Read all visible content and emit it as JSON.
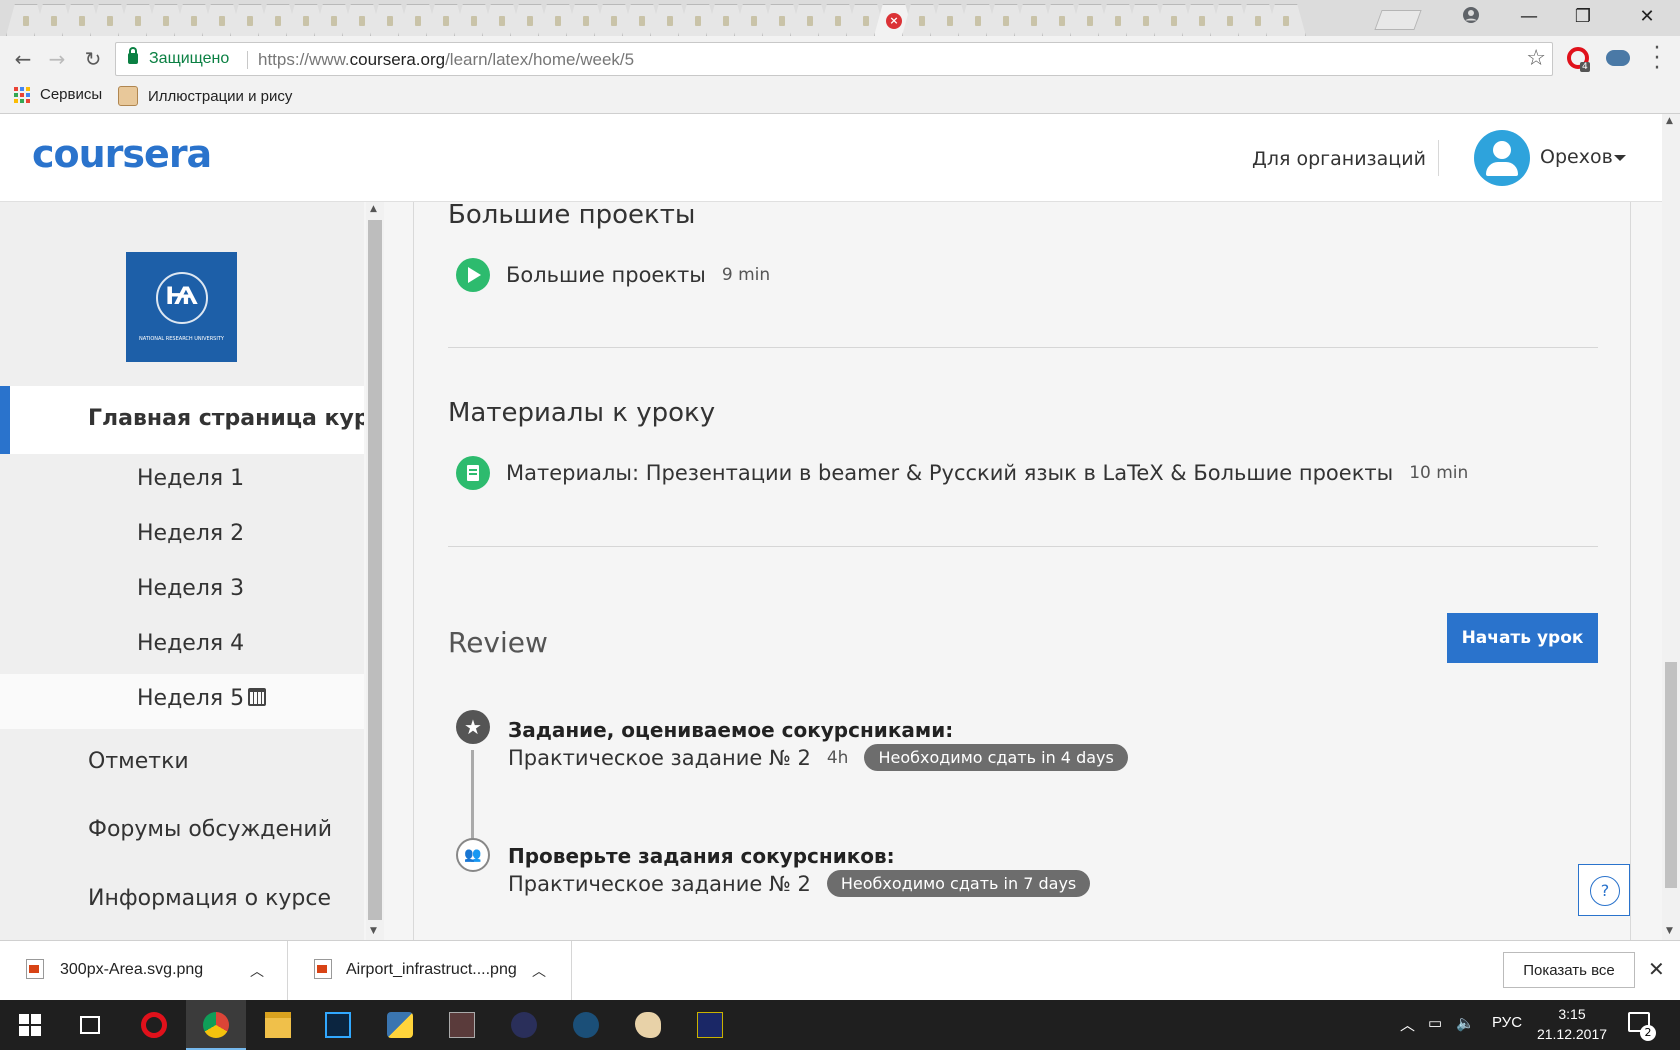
{
  "browser": {
    "secure_label": "Защищено",
    "url_prefix": "https://www.",
    "url_host": "coursera.org",
    "url_path": "/learn/latex/home/week/5",
    "bookmarks": [
      "Сервисы",
      "Иллюстрации и рису"
    ],
    "extension_badge": "4"
  },
  "header": {
    "logo": "coursera",
    "org_link": "Для организаций",
    "username": "Орехов"
  },
  "sidebar": {
    "logo_glyph": "Ѩ",
    "logo_caption": "NATIONAL RESEARCH UNIVERSITY",
    "home": "Главная страница курса",
    "weeks": [
      "Неделя 1",
      "Неделя 2",
      "Неделя 3",
      "Неделя 4",
      "Неделя 5"
    ],
    "current_week": "Неделя 5",
    "links": [
      "Отметки",
      "Форумы обсуждений",
      "Информация о курсе"
    ]
  },
  "main": {
    "section1": {
      "title": "Большие проекты",
      "item_title": "Большие проекты",
      "item_duration": "9 min",
      "item_type": "video"
    },
    "section2": {
      "title": "Материалы к уроку",
      "item_title": "Материалы: Презентации в beamer & Русский язык в LaTeX & Большие проекты",
      "item_duration": "10 min",
      "item_type": "reading"
    },
    "review": {
      "title": "Review",
      "start_button": "Начать урок",
      "assignments": [
        {
          "label": "Задание, оцениваемое сокурсниками:",
          "name": "Практическое задание № 2",
          "time": "4h",
          "due": "Необходимо сдать in 4 days",
          "icon": "star-icon"
        },
        {
          "label": "Проверьте задания сокурсников:",
          "name": "Практическое задание № 2",
          "time": "",
          "due": "Необходимо сдать in 7 days",
          "icon": "people-icon"
        }
      ]
    },
    "help_glyph": "?"
  },
  "downloads": {
    "files": [
      "300px-Area.svg.png",
      "Airport_infrastruct....png"
    ],
    "show_all": "Показать все"
  },
  "taskbar": {
    "language": "РУС",
    "time": "3:15",
    "date": "21.12.2017",
    "notifications": "2"
  },
  "colors": {
    "accent": "#2a73cc",
    "green": "#2dbb6e",
    "secure": "#0b8043"
  }
}
